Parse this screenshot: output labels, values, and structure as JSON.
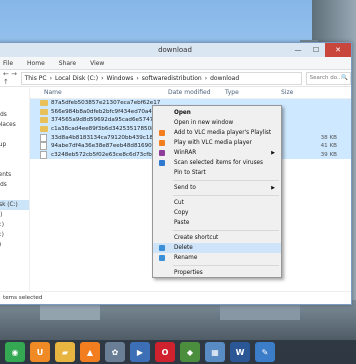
{
  "window": {
    "title": "download",
    "controls": {
      "minimize": "—",
      "maximize": "☐",
      "close": "✕"
    }
  },
  "ribbon": {
    "tabs": [
      "File",
      "Home",
      "Share",
      "View"
    ]
  },
  "address": {
    "nav_arrows": "← → ↑",
    "crumbs": [
      "This PC",
      "Local Disk (C:)",
      "Windows",
      "softwaredistribution",
      "download"
    ],
    "separator": "›",
    "search_placeholder": "Search do...",
    "search_icon": "🔍"
  },
  "nav_pane": {
    "items": [
      "s",
      "op",
      "oads",
      "t places",
      "",
      "roup",
      "",
      "op",
      "ments",
      "oads",
      "",
      "Disk (C:)",
      "(F:)",
      "(G:)",
      "(H:)",
      "(J:)",
      "rk"
    ],
    "selected_index": 11
  },
  "columns": [
    "Name",
    "Date modified",
    "Type",
    "Size"
  ],
  "files": [
    {
      "name": "87a5dfeb503857e21307eca7ebf62e17",
      "type": "folder",
      "selected": true,
      "size": ""
    },
    {
      "name": "566e984b8a0dfeb2bfc9f434ed70a4b8",
      "type": "folder",
      "selected": true,
      "size": ""
    },
    {
      "name": "374565a9d8d59692da95cad6e5747e4b",
      "type": "folder",
      "selected": true,
      "size": ""
    },
    {
      "name": "c1a38cad4ee89f3b6d342535178508dc",
      "type": "folder",
      "selected": true,
      "size": ""
    },
    {
      "name": "33d8a4b8183134ca79120bb439c18ddab71",
      "type": "file",
      "selected": true,
      "size": "38 KB"
    },
    {
      "name": "94abe7df4a36e38e87eeb48d8169093dff18...",
      "type": "file",
      "selected": true,
      "size": "41 KB"
    },
    {
      "name": "c3248eb572cb5f02e63ce8c6d73cfbf39b10",
      "type": "file",
      "selected": true,
      "size": "39 KB"
    }
  ],
  "status": {
    "text": "tems selected"
  },
  "context_menu": {
    "items": [
      {
        "label": "Open",
        "bold": true,
        "icon": "",
        "submenu": false
      },
      {
        "label": "Open in new window",
        "bold": false,
        "icon": "",
        "submenu": false
      },
      {
        "label": "Add to VLC media player's Playlist",
        "bold": false,
        "icon": "vlc-icon",
        "submenu": false
      },
      {
        "label": "Play with VLC media player",
        "bold": false,
        "icon": "vlc-icon",
        "submenu": false
      },
      {
        "label": "WinRAR",
        "bold": false,
        "icon": "winrar-icon",
        "submenu": true
      },
      {
        "label": "Scan selected items for viruses",
        "bold": false,
        "icon": "antivirus-icon",
        "submenu": false
      },
      {
        "label": "Pin to Start",
        "bold": false,
        "icon": "",
        "submenu": false
      },
      {
        "sep": true
      },
      {
        "label": "Send to",
        "bold": false,
        "icon": "",
        "submenu": true
      },
      {
        "sep": true
      },
      {
        "label": "Cut",
        "bold": false,
        "icon": "",
        "submenu": false
      },
      {
        "label": "Copy",
        "bold": false,
        "icon": "",
        "submenu": false
      },
      {
        "label": "Paste",
        "bold": false,
        "icon": "",
        "submenu": false
      },
      {
        "sep": true
      },
      {
        "label": "Create shortcut",
        "bold": false,
        "icon": "",
        "submenu": false
      },
      {
        "label": "Delete",
        "bold": false,
        "icon": "shield-icon",
        "submenu": false,
        "highlighted": true
      },
      {
        "label": "Rename",
        "bold": false,
        "icon": "shield-icon",
        "submenu": false
      },
      {
        "sep": true
      },
      {
        "label": "Properties",
        "bold": false,
        "icon": "",
        "submenu": false
      }
    ],
    "submenu_arrow": "▶"
  },
  "colors": {
    "selection": "#cde8ff",
    "menu_highlight": "#cfe4f8",
    "close_button": "#c9463d"
  },
  "taskbar": {
    "apps": [
      {
        "name": "chrome-icon",
        "glyph": "◉",
        "color": "#34a853"
      },
      {
        "name": "uc-browser-icon",
        "glyph": "U",
        "color": "#f08a24"
      },
      {
        "name": "folder-icon",
        "glyph": "▰",
        "color": "#e8b640"
      },
      {
        "name": "vlc-icon",
        "glyph": "▲",
        "color": "#f37e20"
      },
      {
        "name": "settings-icon",
        "glyph": "✿",
        "color": "#6a7f96"
      },
      {
        "name": "media-icon",
        "glyph": "▶",
        "color": "#3d6fb6"
      },
      {
        "name": "opera-icon",
        "glyph": "O",
        "color": "#d0212e"
      },
      {
        "name": "app-icon",
        "glyph": "◆",
        "color": "#4b8e3d"
      },
      {
        "name": "photos-icon",
        "glyph": "▦",
        "color": "#5a8cc4"
      },
      {
        "name": "word-icon",
        "glyph": "W",
        "color": "#2b5797"
      },
      {
        "name": "paint-icon",
        "glyph": "✎",
        "color": "#3b7dc8"
      }
    ]
  }
}
